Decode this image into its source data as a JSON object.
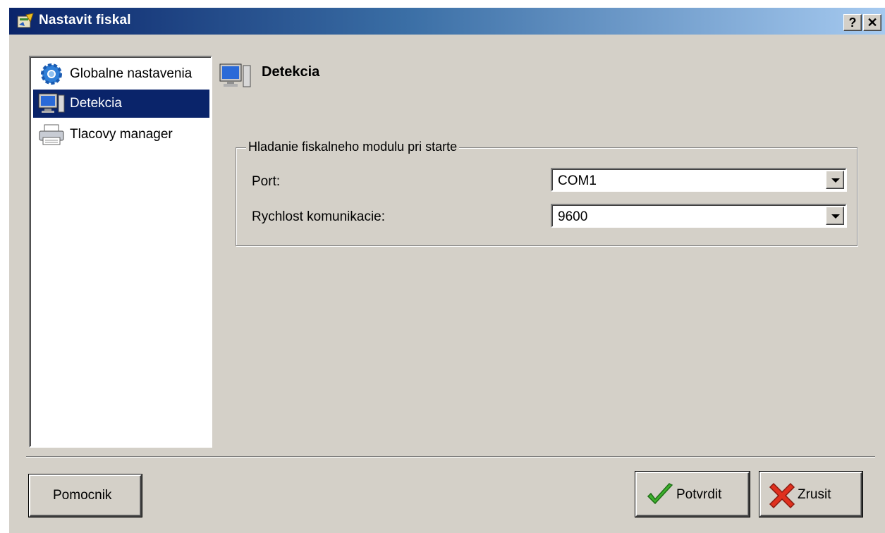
{
  "window": {
    "title": "Nastavit fiskal",
    "help_label": "?",
    "close_label": "✕"
  },
  "sidebar": {
    "items": [
      {
        "label": "Globalne nastavenia",
        "icon": "gear-icon",
        "selected": false
      },
      {
        "label": "Detekcia",
        "icon": "monitor-icon",
        "selected": true
      },
      {
        "label": "Tlacovy manager",
        "icon": "printer-icon",
        "selected": false
      }
    ]
  },
  "panel": {
    "title": "Detekcia",
    "icon": "monitor-icon",
    "group": {
      "legend": "Hladanie fiskalneho modulu pri starte",
      "fields": [
        {
          "label": "Port:",
          "value": "COM1"
        },
        {
          "label": "Rychlost komunikacie:",
          "value": "9600"
        }
      ]
    }
  },
  "buttons": {
    "help": "Pomocnik",
    "confirm": "Potvrdit",
    "cancel": "Zrusit"
  },
  "colors": {
    "selection": "#0a246a",
    "face": "#d4d0c8",
    "confirm_check": "#3cb02c",
    "cancel_x": "#e0301e"
  }
}
